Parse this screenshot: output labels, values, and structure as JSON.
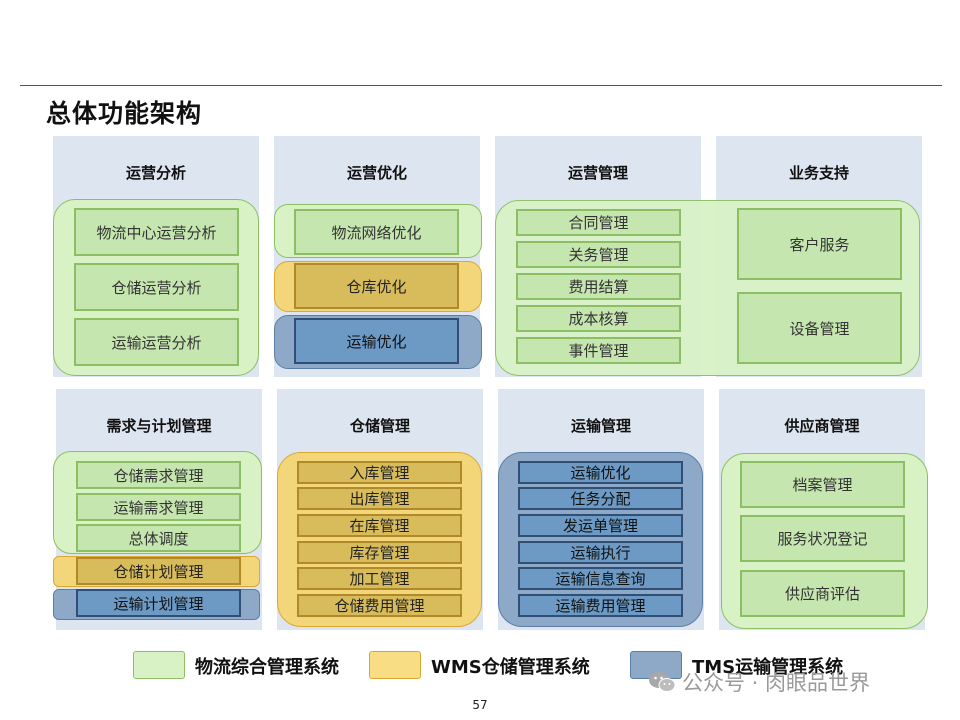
{
  "title": "总体功能架构",
  "panels": {
    "p1": {
      "title": "运营分析",
      "items": [
        "物流中心运营分析",
        "仓储运营分析",
        "运输运营分析"
      ]
    },
    "p2": {
      "title": "运营优化",
      "items": [
        "物流网络优化",
        "仓库优化",
        "运输优化"
      ]
    },
    "p3": {
      "title": "运营管理",
      "items": [
        "合同管理",
        "关务管理",
        "费用结算",
        "成本核算",
        "事件管理"
      ]
    },
    "p4": {
      "title": "业务支持",
      "items": [
        "客户服务",
        "设备管理"
      ]
    },
    "p5": {
      "title": "需求与计划管理",
      "items": [
        "仓储需求管理",
        "运输需求管理",
        "总体调度",
        "仓储计划管理",
        "运输计划管理"
      ]
    },
    "p6": {
      "title": "仓储管理",
      "items": [
        "入库管理",
        "出库管理",
        "在库管理",
        "库存管理",
        "加工管理",
        "仓储费用管理"
      ]
    },
    "p7": {
      "title": "运输管理",
      "items": [
        "运输优化",
        "任务分配",
        "发运单管理",
        "运输执行",
        "运输信息查询",
        "运输费用管理"
      ]
    },
    "p8": {
      "title": "供应商管理",
      "items": [
        "档案管理",
        "服务状况登记",
        "供应商评估"
      ]
    }
  },
  "legend": [
    {
      "label": "物流综合管理系统",
      "color": "#d8f2c6"
    },
    {
      "label": "WMS仓储管理系统",
      "color": "#f9dd85"
    },
    {
      "label": "TMS运输管理系统",
      "color": "#8ea9c8"
    }
  ],
  "watermark": "公众号 · 肉眼品世界",
  "page_number": "57"
}
